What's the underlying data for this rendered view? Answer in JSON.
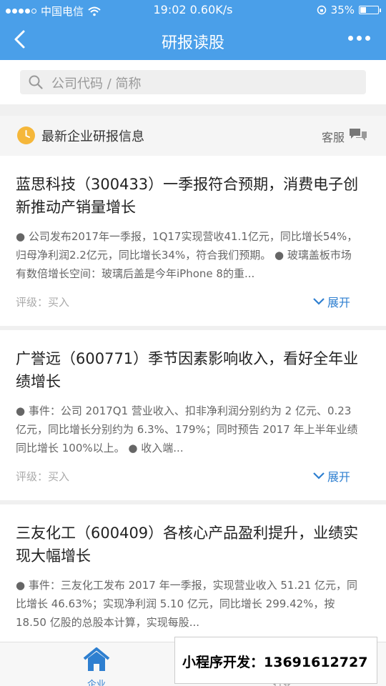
{
  "status_bar": {
    "carrier": "中国电信",
    "time": "19:02 0.60K/s",
    "battery": "35%",
    "battery_level": 0.35
  },
  "nav": {
    "title": "研报读股",
    "back_icon": "back-arrow-icon",
    "more_icon": "more-dots-icon"
  },
  "search": {
    "placeholder": "公司代码 / 简称"
  },
  "section": {
    "title": "最新企业研报信息",
    "customer_service": "客服"
  },
  "reports": [
    {
      "title": "蓝思科技（300433）一季报符合预期，消费电子创新推动产销量增长",
      "summary": "● 公司发布2017年一季报，1Q17实现营收41.1亿元，同比增长54%，归母净利润2.2亿元，同比增长34%，符合我们预期。 ● 玻璃盖板市场有数倍增长空间：玻璃后盖是今年iPhone 8的重...",
      "rating": "评级：买入",
      "expand": "展开"
    },
    {
      "title": "广誉远（600771）季节因素影响收入，看好全年业绩增长",
      "summary": "● 事件：公司 2017Q1 营业收入、扣非净利润分别约为 2 亿元、0.23 亿元，同比增长分别约为 6.3%、179%；同时预告 2017 年上半年业绩同比增长 100%以上。 ● 收入端...",
      "rating": "评级：买入",
      "expand": "展开"
    },
    {
      "title": "三友化工（600409）各核心产品盈利提升，业绩实现大幅增长",
      "summary": "● 事件：三友化工发布 2017 年一季报，实现营业收入 51.21 亿元，同比增长 46.63%；实现净利润 5.10 亿元，同比增长 299.42%，按 18.50 亿股的总股本计算，实现每股..."
    }
  ],
  "tabbar": {
    "enterprise": "企业",
    "industry": "行业"
  },
  "promo": {
    "text": "小程序开发：13691612727"
  },
  "colors": {
    "primary": "#4a9fe9",
    "link": "#2e7fd0",
    "clock": "#f5b73a"
  }
}
